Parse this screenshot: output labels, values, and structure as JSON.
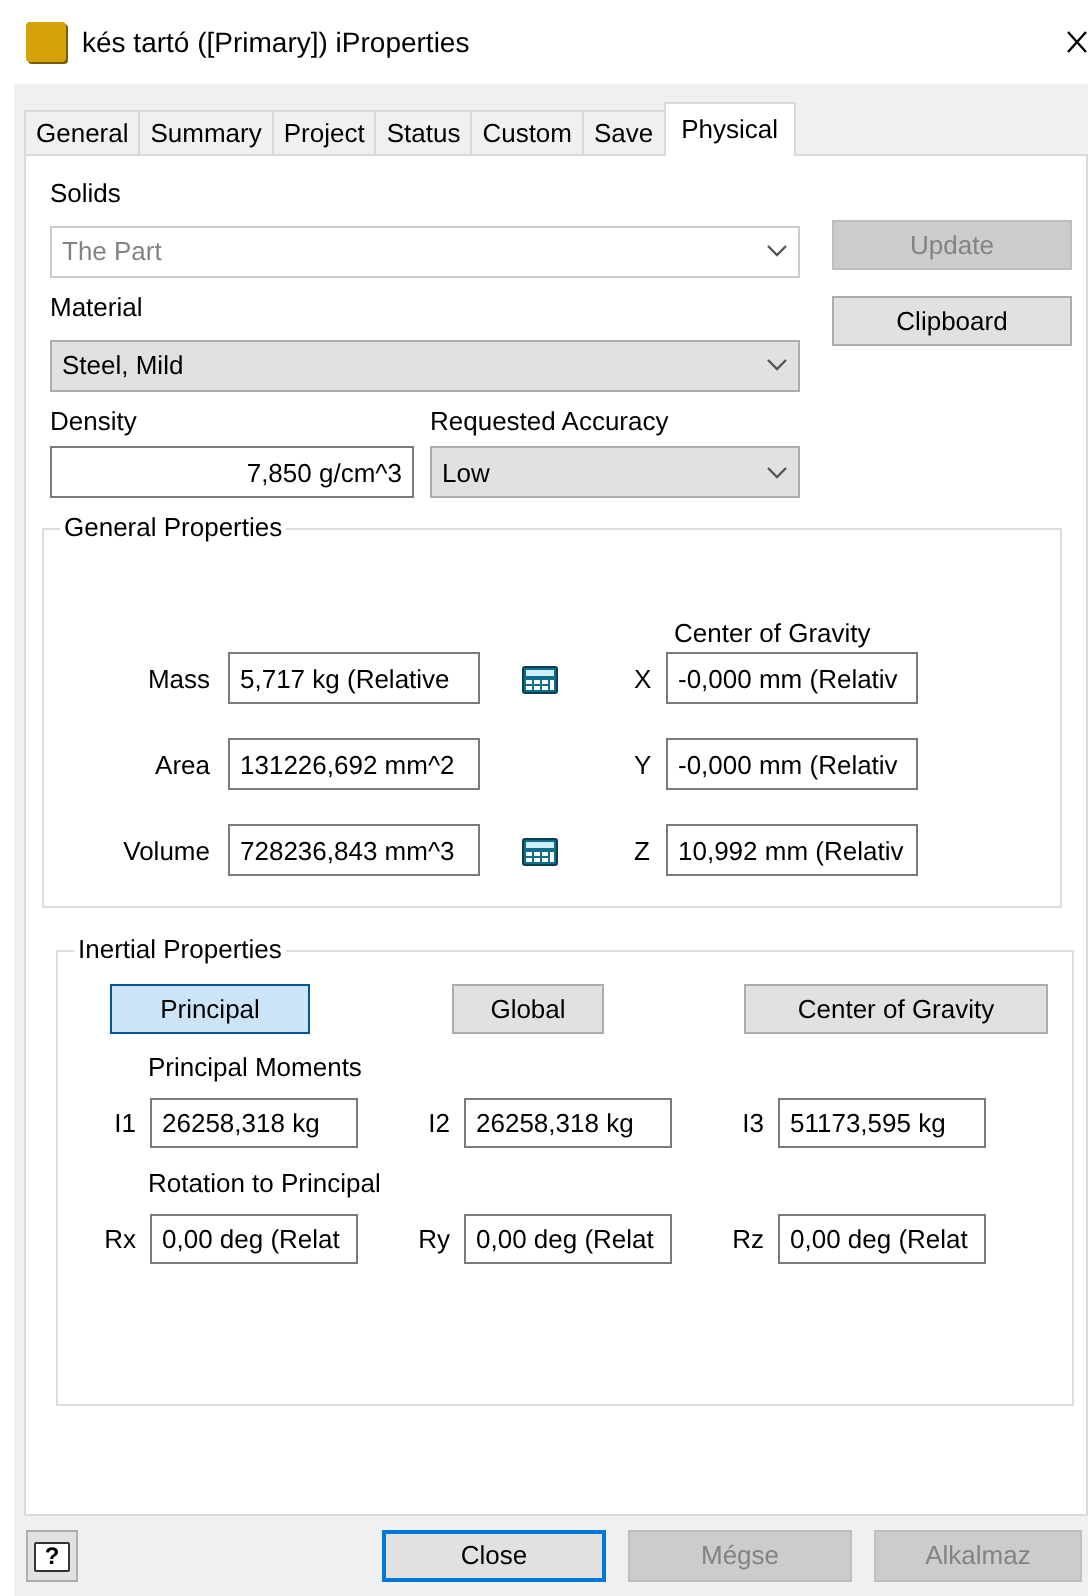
{
  "window": {
    "title": "kés tartó ([Primary]) iProperties"
  },
  "tabs": [
    {
      "label": "General",
      "selected": false
    },
    {
      "label": "Summary",
      "selected": false
    },
    {
      "label": "Project",
      "selected": false
    },
    {
      "label": "Status",
      "selected": false
    },
    {
      "label": "Custom",
      "selected": false
    },
    {
      "label": "Save",
      "selected": false
    },
    {
      "label": "Physical",
      "selected": true
    }
  ],
  "solids": {
    "label": "Solids",
    "value": "The Part",
    "disabled": true
  },
  "material": {
    "label": "Material",
    "value": "Steel, Mild"
  },
  "density": {
    "label": "Density",
    "value": "7,850 g/cm^3"
  },
  "accuracy": {
    "label": "Requested Accuracy",
    "value": "Low"
  },
  "side_buttons": [
    {
      "label": "Update",
      "disabled": true
    },
    {
      "label": "Clipboard",
      "disabled": false
    }
  ],
  "general_properties": {
    "title": "General Properties",
    "cog_title": "Center of Gravity",
    "rows": [
      {
        "label": "Mass",
        "value": "5,717 kg (Relative",
        "calculator": true,
        "axis": "X",
        "cog_value": "-0,000 mm (Relativ"
      },
      {
        "label": "Area",
        "value": "131226,692 mm^2",
        "calculator": false,
        "axis": "Y",
        "cog_value": "-0,000 mm (Relativ"
      },
      {
        "label": "Volume",
        "value": "728236,843 mm^3",
        "calculator": true,
        "axis": "Z",
        "cog_value": "10,992 mm (Relativ"
      }
    ]
  },
  "inertial_properties": {
    "title": "Inertial Properties",
    "modes": [
      {
        "label": "Principal",
        "selected": true
      },
      {
        "label": "Global",
        "selected": false
      },
      {
        "label": "Center of Gravity",
        "selected": false
      }
    ],
    "moments_title": "Principal Moments",
    "moments": [
      {
        "label": "I1",
        "value": "26258,318 kg"
      },
      {
        "label": "I2",
        "value": "26258,318 kg"
      },
      {
        "label": "I3",
        "value": "51173,595 kg"
      }
    ],
    "rotation_title": "Rotation to Principal",
    "rotations": [
      {
        "label": "Rx",
        "value": "0,00 deg (Relat"
      },
      {
        "label": "Ry",
        "value": "0,00 deg (Relat"
      },
      {
        "label": "Rz",
        "value": "0,00 deg (Relat"
      }
    ]
  },
  "footer": {
    "help": "?",
    "buttons": [
      {
        "label": "Close",
        "default": true,
        "disabled": false
      },
      {
        "label": "Mégse",
        "default": false,
        "disabled": true
      },
      {
        "label": "Alkalmaz",
        "default": false,
        "disabled": true
      }
    ]
  }
}
